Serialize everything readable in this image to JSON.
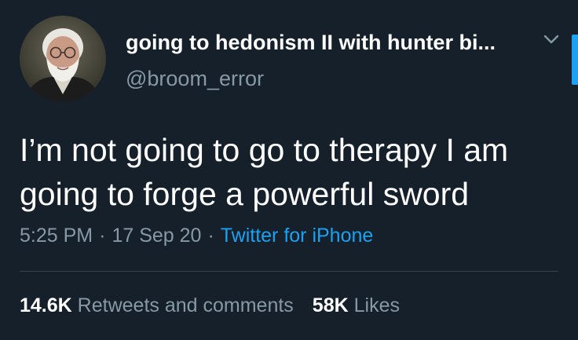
{
  "tweet": {
    "display_name": "going to hedonism II with hunter bi...",
    "handle": "@broom_error",
    "text": "I’m not going to go to therapy I am going to forge a powerful sword",
    "time": "5:25 PM",
    "date": "17 Sep 20",
    "separator": "·",
    "source": "Twitter for iPhone",
    "retweets_count": "14.6K",
    "retweets_label": "Retweets and comments",
    "likes_count": "58K",
    "likes_label": "Likes"
  },
  "icons": {
    "avatar": "profile-photo-elderly-man",
    "menu": "chevron-down-icon"
  },
  "colors": {
    "background": "#15202b",
    "text_primary": "#ffffff",
    "text_secondary": "#8899a6",
    "accent": "#1da1f2",
    "divider": "#38444d"
  }
}
